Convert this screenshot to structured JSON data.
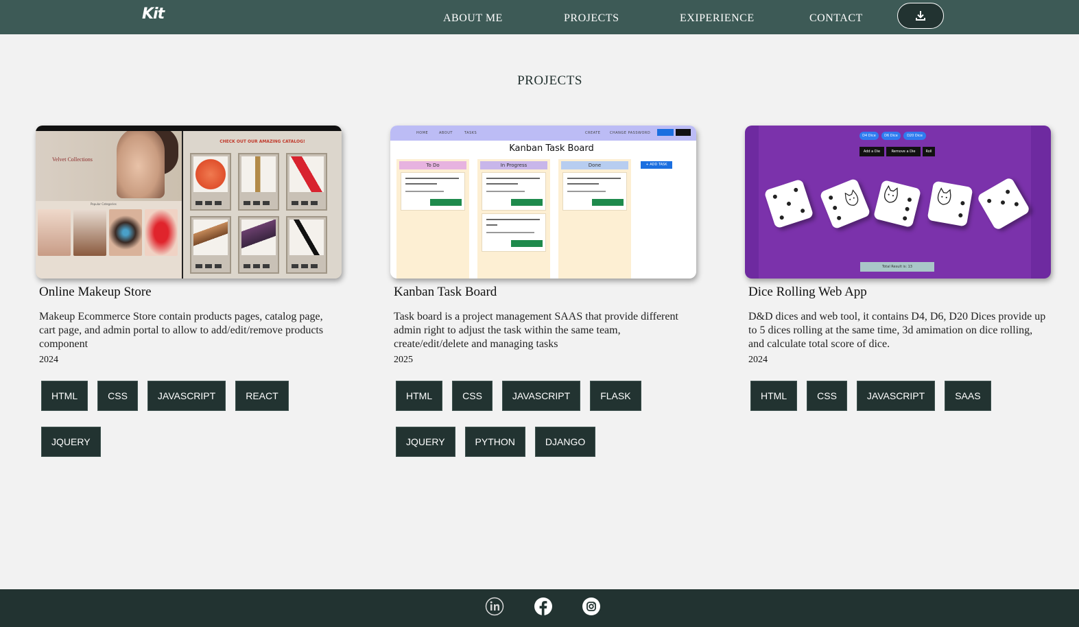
{
  "nav": {
    "logo": "Kit",
    "links": [
      "ABOUT ME",
      "PROJECTS",
      "EXIPERIENCE",
      "CONTACT"
    ],
    "download_icon": "download-icon"
  },
  "section": {
    "title": "PROJECTS"
  },
  "projects": [
    {
      "title": "Online Makeup Store",
      "description": "Makeup Ecommerce Store contain products pages, catalog page, cart page, and admin portal to allow to add/edit/remove products component",
      "year": "2024",
      "tags": [
        "HTML",
        "CSS",
        "JAVASCRIPT",
        "REACT",
        "JQUERY"
      ],
      "thumb": {
        "brand": "Velvet Collections",
        "categories_label": "Popular Categories",
        "catalog_heading": "CHECK OUT OUR AMAZING CATALOG!"
      }
    },
    {
      "title": "Kanban Task Board",
      "description": "Task board is a project management SAAS that provide different admin right to adjust the task within the same team, create/edit/delete and managing tasks",
      "year": "2025",
      "tags": [
        "HTML",
        "CSS",
        "JAVASCRIPT",
        "FLASK",
        "JQUERY",
        "PYTHON",
        "DJANGO"
      ],
      "thumb": {
        "nav_links": [
          "HOME",
          "ABOUT",
          "TASKS",
          "CREATE",
          "CHANGE PASSWORD"
        ],
        "heading": "Kanban Task Board",
        "columns": [
          "To Do",
          "In Progress",
          "Done"
        ],
        "add_task": "+ ADD TASK"
      }
    },
    {
      "title": "Dice Rolling Web App",
      "description": "D&D dices and web tool, it contains D4, D6, D20 Dices provide up to 5 dices rolling at the same time, 3d amimation on dice rolling, and calculate total score of dice.",
      "year": "2024",
      "tags": [
        "HTML",
        "CSS",
        "JAVASCRIPT",
        "SAAS"
      ],
      "thumb": {
        "dice_types": [
          "D4 Dice",
          "D6 Dice",
          "D20 Dice"
        ],
        "controls": [
          "Add a Die",
          "Remove a Die",
          "Roll"
        ],
        "total": "Total Result is: 13"
      }
    }
  ],
  "footer": {
    "icons": [
      "linkedin-icon",
      "facebook-icon",
      "instagram-icon"
    ]
  },
  "colors": {
    "nav_bg": "#3d5a56",
    "footer_bg": "#223331",
    "tag_bg": "#223331",
    "page_bg": "#f2f2f2"
  }
}
